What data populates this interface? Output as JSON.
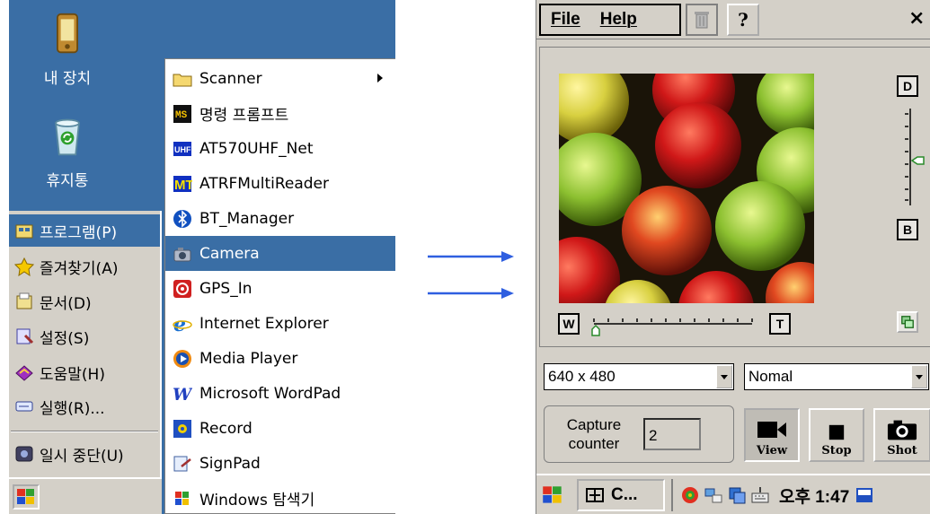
{
  "desktop": {
    "icons": [
      {
        "label": "내 장치",
        "icon": "pda-icon"
      },
      {
        "label": "휴지통",
        "icon": "recycle-bin-icon"
      }
    ]
  },
  "start_menu": {
    "items": [
      {
        "label": "프로그램(P)",
        "icon": "programs-icon",
        "active": true
      },
      {
        "label": "즐겨찾기(A)",
        "icon": "favorites-icon"
      },
      {
        "label": "문서(D)",
        "icon": "documents-icon"
      },
      {
        "label": "설정(S)",
        "icon": "settings-icon"
      },
      {
        "label": "도움말(H)",
        "icon": "help-book-icon"
      },
      {
        "label": "실행(R)...",
        "icon": "run-icon"
      },
      {
        "label": "일시 중단(U)",
        "icon": "suspend-icon"
      }
    ]
  },
  "programs_submenu": {
    "items": [
      {
        "label": "Scanner",
        "icon": "folder-icon",
        "has_submenu": true
      },
      {
        "label": "명령 프롬프트",
        "icon": "command-prompt-icon"
      },
      {
        "label": "AT570UHF_Net",
        "icon": "uhf-icon"
      },
      {
        "label": "ATRFMultiReader",
        "icon": "mt-icon"
      },
      {
        "label": "BT_Manager",
        "icon": "bluetooth-icon"
      },
      {
        "label": "Camera",
        "icon": "camera-icon",
        "active": true
      },
      {
        "label": "GPS_In",
        "icon": "gps-icon"
      },
      {
        "label": "Internet Explorer",
        "icon": "internet-explorer-icon"
      },
      {
        "label": "Media Player",
        "icon": "media-player-icon"
      },
      {
        "label": "Microsoft WordPad",
        "icon": "wordpad-icon"
      },
      {
        "label": "Record",
        "icon": "record-icon"
      },
      {
        "label": "SignPad",
        "icon": "signpad-icon"
      },
      {
        "label": "Windows 탐색기",
        "icon": "explorer-icon"
      }
    ]
  },
  "camera_app": {
    "menu": {
      "file": "File",
      "help": "Help"
    },
    "toolbar": {
      "delete_icon": "trash-icon",
      "help_icon": "question-icon",
      "close": "×"
    },
    "zoom_buttons": {
      "wide": "W",
      "tele": "T"
    },
    "brightness_buttons": {
      "dark": "D",
      "bright": "B"
    },
    "resolution": {
      "value": "640 x 480"
    },
    "mode": {
      "value": "Nomal"
    },
    "capture": {
      "label": "Capture counter",
      "value": "2"
    },
    "buttons": {
      "view": "View",
      "stop": "Stop",
      "shot": "Shot"
    },
    "taskbar": {
      "task": "C...",
      "clock": "오후 1:47"
    }
  },
  "colors": {
    "desktop": "#3a6ea5",
    "highlight": "#3a6ea5",
    "face": "#d4d0c8",
    "arrow": "#2f5fe0"
  }
}
